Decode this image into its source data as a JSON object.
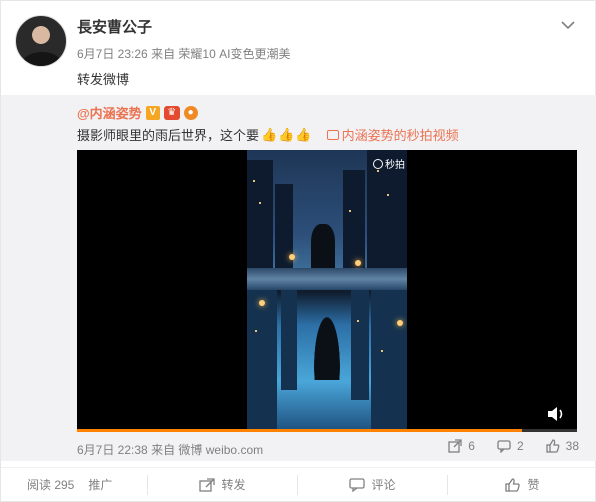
{
  "post": {
    "author": "長安曹公子",
    "time": "6月7日 23:26",
    "source_prefix": "来自",
    "source": "荣耀10 AI变色更潮美",
    "text": "转发微博"
  },
  "original": {
    "author": "@内涵姿势",
    "text": "摄影师眼里的雨后世界，这个要",
    "thumbs": "👍👍👍",
    "video_link": "内涵姿势的秒拍视频",
    "time": "6月7日 22:38",
    "source_prefix": "来自",
    "source": "微博 weibo.com",
    "actions": {
      "forward_count": "6",
      "comment_count": "2",
      "like_count": "38"
    },
    "video": {
      "watermark": "秒拍",
      "progress": 0.89
    }
  },
  "footer": {
    "reads_label": "阅读 295",
    "promote_label": "推广",
    "forward_label": "转发",
    "comment_label": "评论",
    "like_label": "赞"
  },
  "colors": {
    "accent": "#eb7350",
    "progress": "#ff8200",
    "muted": "#808080"
  },
  "icons": [
    "chevron-down-icon",
    "verified-v-icon",
    "vip-icon",
    "lightbulb-icon",
    "video-icon",
    "camera-icon",
    "volume-icon",
    "forward-icon",
    "comment-icon",
    "like-icon"
  ]
}
